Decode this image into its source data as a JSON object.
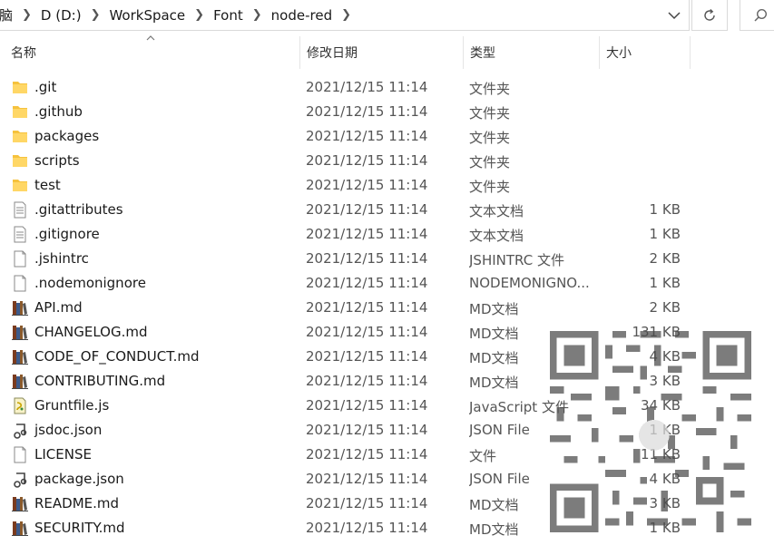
{
  "address_bar": {
    "breadcrumbs": [
      "脑",
      "D (D:)",
      "WorkSpace",
      "Font",
      "node-red"
    ]
  },
  "columns": {
    "name": "名称",
    "date": "修改日期",
    "type": "类型",
    "size": "大小"
  },
  "files": [
    {
      "name": ".git",
      "date": "2021/12/15 11:14",
      "type": "文件夹",
      "size": "",
      "icon": "folder"
    },
    {
      "name": ".github",
      "date": "2021/12/15 11:14",
      "type": "文件夹",
      "size": "",
      "icon": "folder"
    },
    {
      "name": "packages",
      "date": "2021/12/15 11:14",
      "type": "文件夹",
      "size": "",
      "icon": "folder"
    },
    {
      "name": "scripts",
      "date": "2021/12/15 11:14",
      "type": "文件夹",
      "size": "",
      "icon": "folder"
    },
    {
      "name": "test",
      "date": "2021/12/15 11:14",
      "type": "文件夹",
      "size": "",
      "icon": "folder"
    },
    {
      "name": ".gitattributes",
      "date": "2021/12/15 11:14",
      "type": "文本文档",
      "size": "1 KB",
      "icon": "text"
    },
    {
      "name": ".gitignore",
      "date": "2021/12/15 11:14",
      "type": "文本文档",
      "size": "1 KB",
      "icon": "text"
    },
    {
      "name": ".jshintrc",
      "date": "2021/12/15 11:14",
      "type": "JSHINTRC 文件",
      "size": "2 KB",
      "icon": "blank"
    },
    {
      "name": ".nodemonignore",
      "date": "2021/12/15 11:14",
      "type": "NODEMONIGNO...",
      "size": "1 KB",
      "icon": "blank"
    },
    {
      "name": "API.md",
      "date": "2021/12/15 11:14",
      "type": "MD文档",
      "size": "2 KB",
      "icon": "books"
    },
    {
      "name": "CHANGELOG.md",
      "date": "2021/12/15 11:14",
      "type": "MD文档",
      "size": "131 KB",
      "icon": "books"
    },
    {
      "name": "CODE_OF_CONDUCT.md",
      "date": "2021/12/15 11:14",
      "type": "MD文档",
      "size": "4 KB",
      "icon": "books"
    },
    {
      "name": "CONTRIBUTING.md",
      "date": "2021/12/15 11:14",
      "type": "MD文档",
      "size": "3 KB",
      "icon": "books"
    },
    {
      "name": "Gruntfile.js",
      "date": "2021/12/15 11:14",
      "type": "JavaScript 文件",
      "size": "34 KB",
      "icon": "js"
    },
    {
      "name": "jsdoc.json",
      "date": "2021/12/15 11:14",
      "type": "JSON File",
      "size": "1 KB",
      "icon": "json"
    },
    {
      "name": "LICENSE",
      "date": "2021/12/15 11:14",
      "type": "文件",
      "size": "11 KB",
      "icon": "blank"
    },
    {
      "name": "package.json",
      "date": "2021/12/15 11:14",
      "type": "JSON File",
      "size": "4 KB",
      "icon": "json"
    },
    {
      "name": "README.md",
      "date": "2021/12/15 11:14",
      "type": "MD文档",
      "size": "3 KB",
      "icon": "books"
    },
    {
      "name": "SECURITY.md",
      "date": "2021/12/15 11:14",
      "type": "MD文档",
      "size": "1 KB",
      "icon": "books"
    }
  ]
}
